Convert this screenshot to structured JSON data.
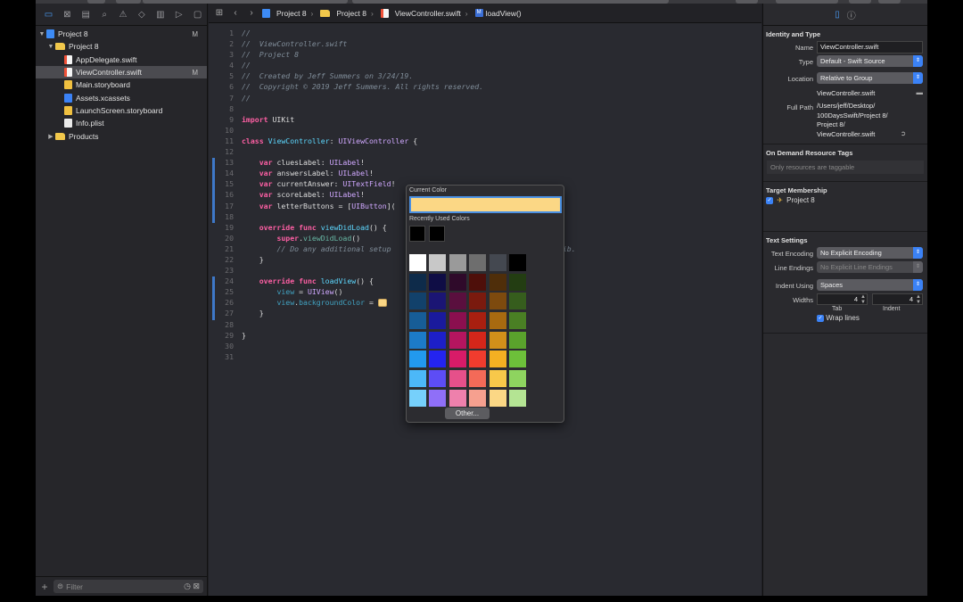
{
  "navigator": {
    "items": [
      {
        "label": "Project 8",
        "badge": "M",
        "kind": "proj",
        "indent": 0,
        "disclosure": "▼"
      },
      {
        "label": "Project 8",
        "badge": "",
        "kind": "folder",
        "indent": 1,
        "disclosure": "▼"
      },
      {
        "label": "AppDelegate.swift",
        "badge": "",
        "kind": "swift",
        "indent": 2,
        "disclosure": ""
      },
      {
        "label": "ViewController.swift",
        "badge": "M",
        "kind": "swift",
        "indent": 2,
        "disclosure": "",
        "selected": true
      },
      {
        "label": "Main.storyboard",
        "badge": "",
        "kind": "sb",
        "indent": 2,
        "disclosure": ""
      },
      {
        "label": "Assets.xcassets",
        "badge": "",
        "kind": "xcassets",
        "indent": 2,
        "disclosure": ""
      },
      {
        "label": "LaunchScreen.storyboard",
        "badge": "",
        "kind": "sb",
        "indent": 2,
        "disclosure": ""
      },
      {
        "label": "Info.plist",
        "badge": "",
        "kind": "plist",
        "indent": 2,
        "disclosure": ""
      },
      {
        "label": "Products",
        "badge": "",
        "kind": "folder",
        "indent": 1,
        "disclosure": "▶"
      }
    ],
    "filter_placeholder": "Filter"
  },
  "jumpbar": {
    "crumbs": [
      "Project 8",
      "Project 8",
      "ViewController.swift",
      "loadView()"
    ]
  },
  "code": {
    "lines": [
      {
        "n": "1",
        "html": "<span class='cm'>//</span>"
      },
      {
        "n": "2",
        "html": "<span class='cm'>//  ViewController.swift</span>"
      },
      {
        "n": "3",
        "html": "<span class='cm'>//  Project 8</span>"
      },
      {
        "n": "4",
        "html": "<span class='cm'>//</span>"
      },
      {
        "n": "5",
        "html": "<span class='cm'>//  Created by Jeff Summers on 3/24/19.</span>"
      },
      {
        "n": "6",
        "html": "<span class='cm'>//  Copyright © 2019 Jeff Summers. All rights reserved.</span>"
      },
      {
        "n": "7",
        "html": "<span class='cm'>//</span>"
      },
      {
        "n": "8",
        "html": ""
      },
      {
        "n": "9",
        "html": "<span class='kw'>import</span> UIKit"
      },
      {
        "n": "10",
        "html": ""
      },
      {
        "n": "11",
        "html": "<span class='kw'>class</span> <span class='ty'>ViewController</span>: <span class='tyc'>UIViewController</span> {"
      },
      {
        "n": "12",
        "html": ""
      },
      {
        "n": "13",
        "html": "    <span class='kw'>var</span> cluesLabel: <span class='tyc'>UILabel</span>!"
      },
      {
        "n": "14",
        "html": "    <span class='kw'>var</span> answersLabel: <span class='tyc'>UILabel</span>!"
      },
      {
        "n": "15",
        "html": "    <span class='kw'>var</span> currentAnswer: <span class='tyc'>UITextField</span>!"
      },
      {
        "n": "16",
        "html": "    <span class='kw'>var</span> scoreLabel: <span class='tyc'>UILabel</span>!"
      },
      {
        "n": "17",
        "html": "    <span class='kw'>var</span> letterButtons = [<span class='tyc'>UIButton</span>]("
      },
      {
        "n": "18",
        "html": ""
      },
      {
        "n": "19",
        "html": "    <span class='kw'>override</span> <span class='kw'>func</span> <span class='ty'>viewDidLoad</span>() {"
      },
      {
        "n": "20",
        "html": "        <span class='kw'>super</span>.<span class='fn'>viewDidLoad</span>()"
      },
      {
        "n": "21",
        "html": "        <span class='cm'>// Do any additional setup                       pically from a nib.</span>"
      },
      {
        "n": "22",
        "html": "    }"
      },
      {
        "n": "23",
        "html": ""
      },
      {
        "n": "24",
        "html": "    <span class='kw'>override</span> <span class='kw'>func</span> <span class='ty'>loadView</span>() {"
      },
      {
        "n": "25",
        "html": "        <span class='vr'>view</span> = <span class='tyc'>UIView</span>()"
      },
      {
        "n": "26",
        "html": "        <span class='vr'>view</span>.<span class='vr'>backgroundColor</span> = <span class='swatch-inline'></span>"
      },
      {
        "n": "27",
        "html": "    }"
      },
      {
        "n": "28",
        "html": ""
      },
      {
        "n": "29",
        "html": "}"
      },
      {
        "n": "30",
        "html": ""
      },
      {
        "n": "31",
        "html": ""
      }
    ]
  },
  "picker": {
    "current_label": "Current Color",
    "current_color": "#fbd785",
    "recent_label": "Recently Used Colors",
    "recent_colors": [
      "#000000",
      "#000000"
    ],
    "other_label": "Other...",
    "grid": [
      [
        "#ffffff",
        "#c8c8c8",
        "#9a9a9a",
        "#6e6e6e",
        "#444850",
        "#000000"
      ],
      [
        "#0e2b4a",
        "#0f0d45",
        "#2f0a2a",
        "#4e0f0a",
        "#4f2e0a",
        "#233d12"
      ],
      [
        "#12416b",
        "#1b1574",
        "#5a0f3e",
        "#7a1a0e",
        "#7d4a0e",
        "#365d1d"
      ],
      [
        "#175d97",
        "#1a1a9c",
        "#8b0f4f",
        "#a81f10",
        "#a86a10",
        "#4a7f24"
      ],
      [
        "#1c7bc8",
        "#1d1fc8",
        "#b5155f",
        "#d4261a",
        "#d2901a",
        "#5aa22c"
      ],
      [
        "#2299ee",
        "#2424f0",
        "#d81b68",
        "#f03c2e",
        "#f4b022",
        "#6dc03a"
      ],
      [
        "#4cb8f8",
        "#5d4df5",
        "#e6508a",
        "#f46a58",
        "#f8c84a",
        "#8ed45f"
      ],
      [
        "#76d0fb",
        "#8f6ff8",
        "#ee80ac",
        "#f6a08f",
        "#fbd785",
        "#b4e493"
      ]
    ]
  },
  "inspector": {
    "identity_title": "Identity and Type",
    "name_label": "Name",
    "name_value": "ViewController.swift",
    "type_label": "Type",
    "type_value": "Default - Swift Source",
    "location_label": "Location",
    "location_value": "Relative to Group",
    "location_file": "ViewController.swift",
    "fullpath_label": "Full Path",
    "fullpath_lines": [
      "/Users/jeff/Desktop/",
      "100DaysSwift/Project 8/",
      "Project 8/",
      "ViewController.swift"
    ],
    "ondemand_title": "On Demand Resource Tags",
    "ondemand_placeholder": "Only resources are taggable",
    "target_title": "Target Membership",
    "target_item": "Project 8",
    "text_settings_title": "Text Settings",
    "encoding_label": "Text Encoding",
    "encoding_value": "No Explicit Encoding",
    "endings_label": "Line Endings",
    "endings_value": "No Explicit Line Endings",
    "indent_using_label": "Indent Using",
    "indent_using_value": "Spaces",
    "widths_label": "Widths",
    "tab_value": "4",
    "indent_value": "4",
    "tab_label": "Tab",
    "indent_label": "Indent",
    "wrap_label": "Wrap lines"
  }
}
